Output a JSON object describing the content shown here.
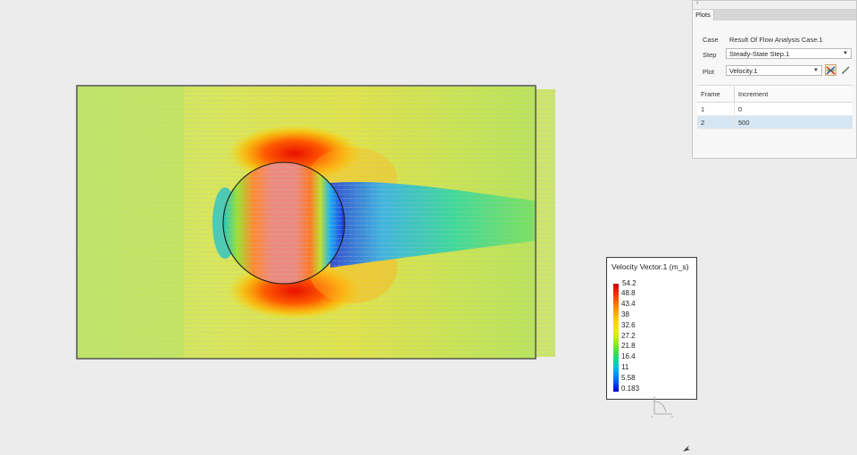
{
  "panel": {
    "tab_label": "Plots",
    "case_label": "Case",
    "case_value": "Result Of Flow Analysis Case.1",
    "step_label": "Step",
    "step_value": "Steady-State Step.1",
    "plot_label": "Plot",
    "plot_value": "Velocity.1",
    "table": {
      "headers": [
        "Frame",
        "Increment"
      ],
      "rows": [
        {
          "frame": "1",
          "increment": "0"
        },
        {
          "frame": "2",
          "increment": "500"
        }
      ],
      "selected_index": 1
    }
  },
  "legend": {
    "title": "Velocity Vector.1 (m_s)",
    "ticks": [
      "54.2",
      "48.8",
      "43.4",
      "38",
      "32.6",
      "27.2",
      "21.8",
      "16.4",
      "11",
      "5.58",
      "0.183"
    ]
  },
  "icons": {
    "collapse": "chevron-right-icon",
    "plot_tool": "color-plot-icon",
    "edit": "pencil-icon",
    "triad": "axis-triad-icon",
    "cursor": "mouse-pointer-icon"
  },
  "colors": {
    "selected_row": "#d6e6f2",
    "legend_high": "#c00000",
    "legend_low": "#0000cc"
  }
}
